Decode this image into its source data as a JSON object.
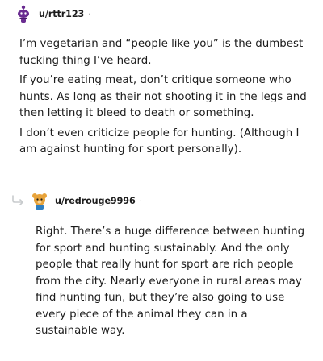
{
  "comments": [
    {
      "username": "u/rttr123",
      "separator": "·",
      "paragraphs": [
        "I’m vegetarian and “people like you” is the dumbest fucking thing I’ve heard.",
        "If you’re eating meat, don’t critique someone who hunts. As long as their not shooting it in the legs and then letting it bleed to death or something.",
        "I don’t even criticize people for hunting. (Although I am against hunting for sport personally)."
      ]
    },
    {
      "username": "u/redrouge9996",
      "separator": "·",
      "paragraphs": [
        "Right. There’s a huge difference between hunting for sport and hunting sustainably. And the only people that really hunt for sport are rich people from the city. Nearly everyone in rural areas may find hunting fun, but they’re also going to use every piece of the animal they can in a sustainable way."
      ]
    }
  ],
  "colors": {
    "avatar1": "#6a2c91",
    "avatar2": "#e8a33a",
    "text": "#1c1c1c",
    "meta": "#7c7c7c",
    "thread_line": "#c8cbcd"
  },
  "icons": {
    "avatar1": "snoo-avatar-icon",
    "avatar2": "snoo-avatar-icon",
    "reply": "reply-arrow-icon"
  }
}
